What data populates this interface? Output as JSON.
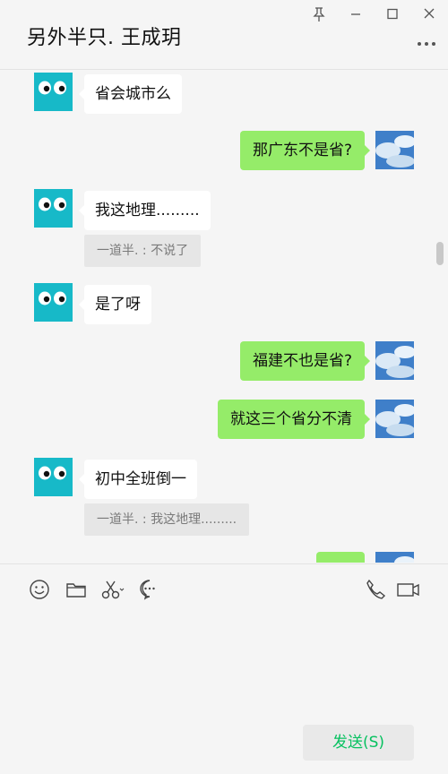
{
  "header": {
    "title": "另外半只. 王成玥"
  },
  "messages": [
    {
      "side": "left",
      "text": "省会城市么"
    },
    {
      "side": "right",
      "text": "那广东不是省?"
    },
    {
      "side": "left",
      "text": "我这地理.........",
      "quote": "一道半. : 不说了"
    },
    {
      "side": "left",
      "text": "是了呀"
    },
    {
      "side": "right",
      "text": "福建不也是省?"
    },
    {
      "side": "right",
      "text": "就这三个省分不清"
    },
    {
      "side": "left",
      "text": "初中全班倒一",
      "quote": "一道半. : 我这地理........."
    },
    {
      "side": "right",
      "text": ""
    }
  ],
  "toolbar": {
    "icons": [
      "emoji-icon",
      "folder-icon",
      "scissors-icon",
      "chat-history-icon",
      "phone-icon",
      "video-icon"
    ]
  },
  "composer": {
    "value": "",
    "send_label": "发送(S)"
  },
  "colors": {
    "sent_bubble": "#95ec69",
    "received_bubble": "#ffffff",
    "send_text": "#07c160",
    "avatar_bg": "#17b9c8"
  }
}
